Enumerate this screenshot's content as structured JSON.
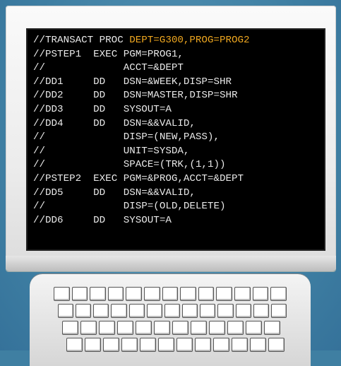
{
  "jcl": {
    "lines": [
      {
        "label": "//TRANSACT",
        "op": "PROC",
        "params": "",
        "highlight": "DEPT=G300,PROG=PROG2"
      },
      {
        "label": "//PSTEP1",
        "op": "EXEC",
        "params": "PGM=PROG1,",
        "highlight": ""
      },
      {
        "label": "//",
        "op": "",
        "params": "ACCT=&DEPT",
        "highlight": ""
      },
      {
        "label": "//DD1",
        "op": "DD",
        "params": "DSN=&WEEK,DISP=SHR",
        "highlight": ""
      },
      {
        "label": "//DD2",
        "op": "DD",
        "params": "DSN=MASTER,DISP=SHR",
        "highlight": ""
      },
      {
        "label": "//DD3",
        "op": "DD",
        "params": "SYSOUT=A",
        "highlight": ""
      },
      {
        "label": "//DD4",
        "op": "DD",
        "params": "DSN=&&VALID,",
        "highlight": ""
      },
      {
        "label": "//",
        "op": "",
        "params": "DISP=(NEW,PASS),",
        "highlight": ""
      },
      {
        "label": "//",
        "op": "",
        "params": "UNIT=SYSDA,",
        "highlight": ""
      },
      {
        "label": "//",
        "op": "",
        "params": "SPACE=(TRK,(1,1))",
        "highlight": ""
      },
      {
        "label": "//PSTEP2",
        "op": "EXEC",
        "params": "PGM=&PROG,ACCT=&DEPT",
        "highlight": ""
      },
      {
        "label": "//DD5",
        "op": "DD",
        "params": "DSN=&&VALID,",
        "highlight": ""
      },
      {
        "label": "//",
        "op": "",
        "params": "DISP=(OLD,DELETE)",
        "highlight": ""
      },
      {
        "label": "//DD6",
        "op": "DD",
        "params": "SYSOUT=A",
        "highlight": ""
      }
    ]
  },
  "colors": {
    "background": "#3f7fa2",
    "screen": "#000000",
    "text": "#e9e9e9",
    "highlight": "#f0a820"
  }
}
